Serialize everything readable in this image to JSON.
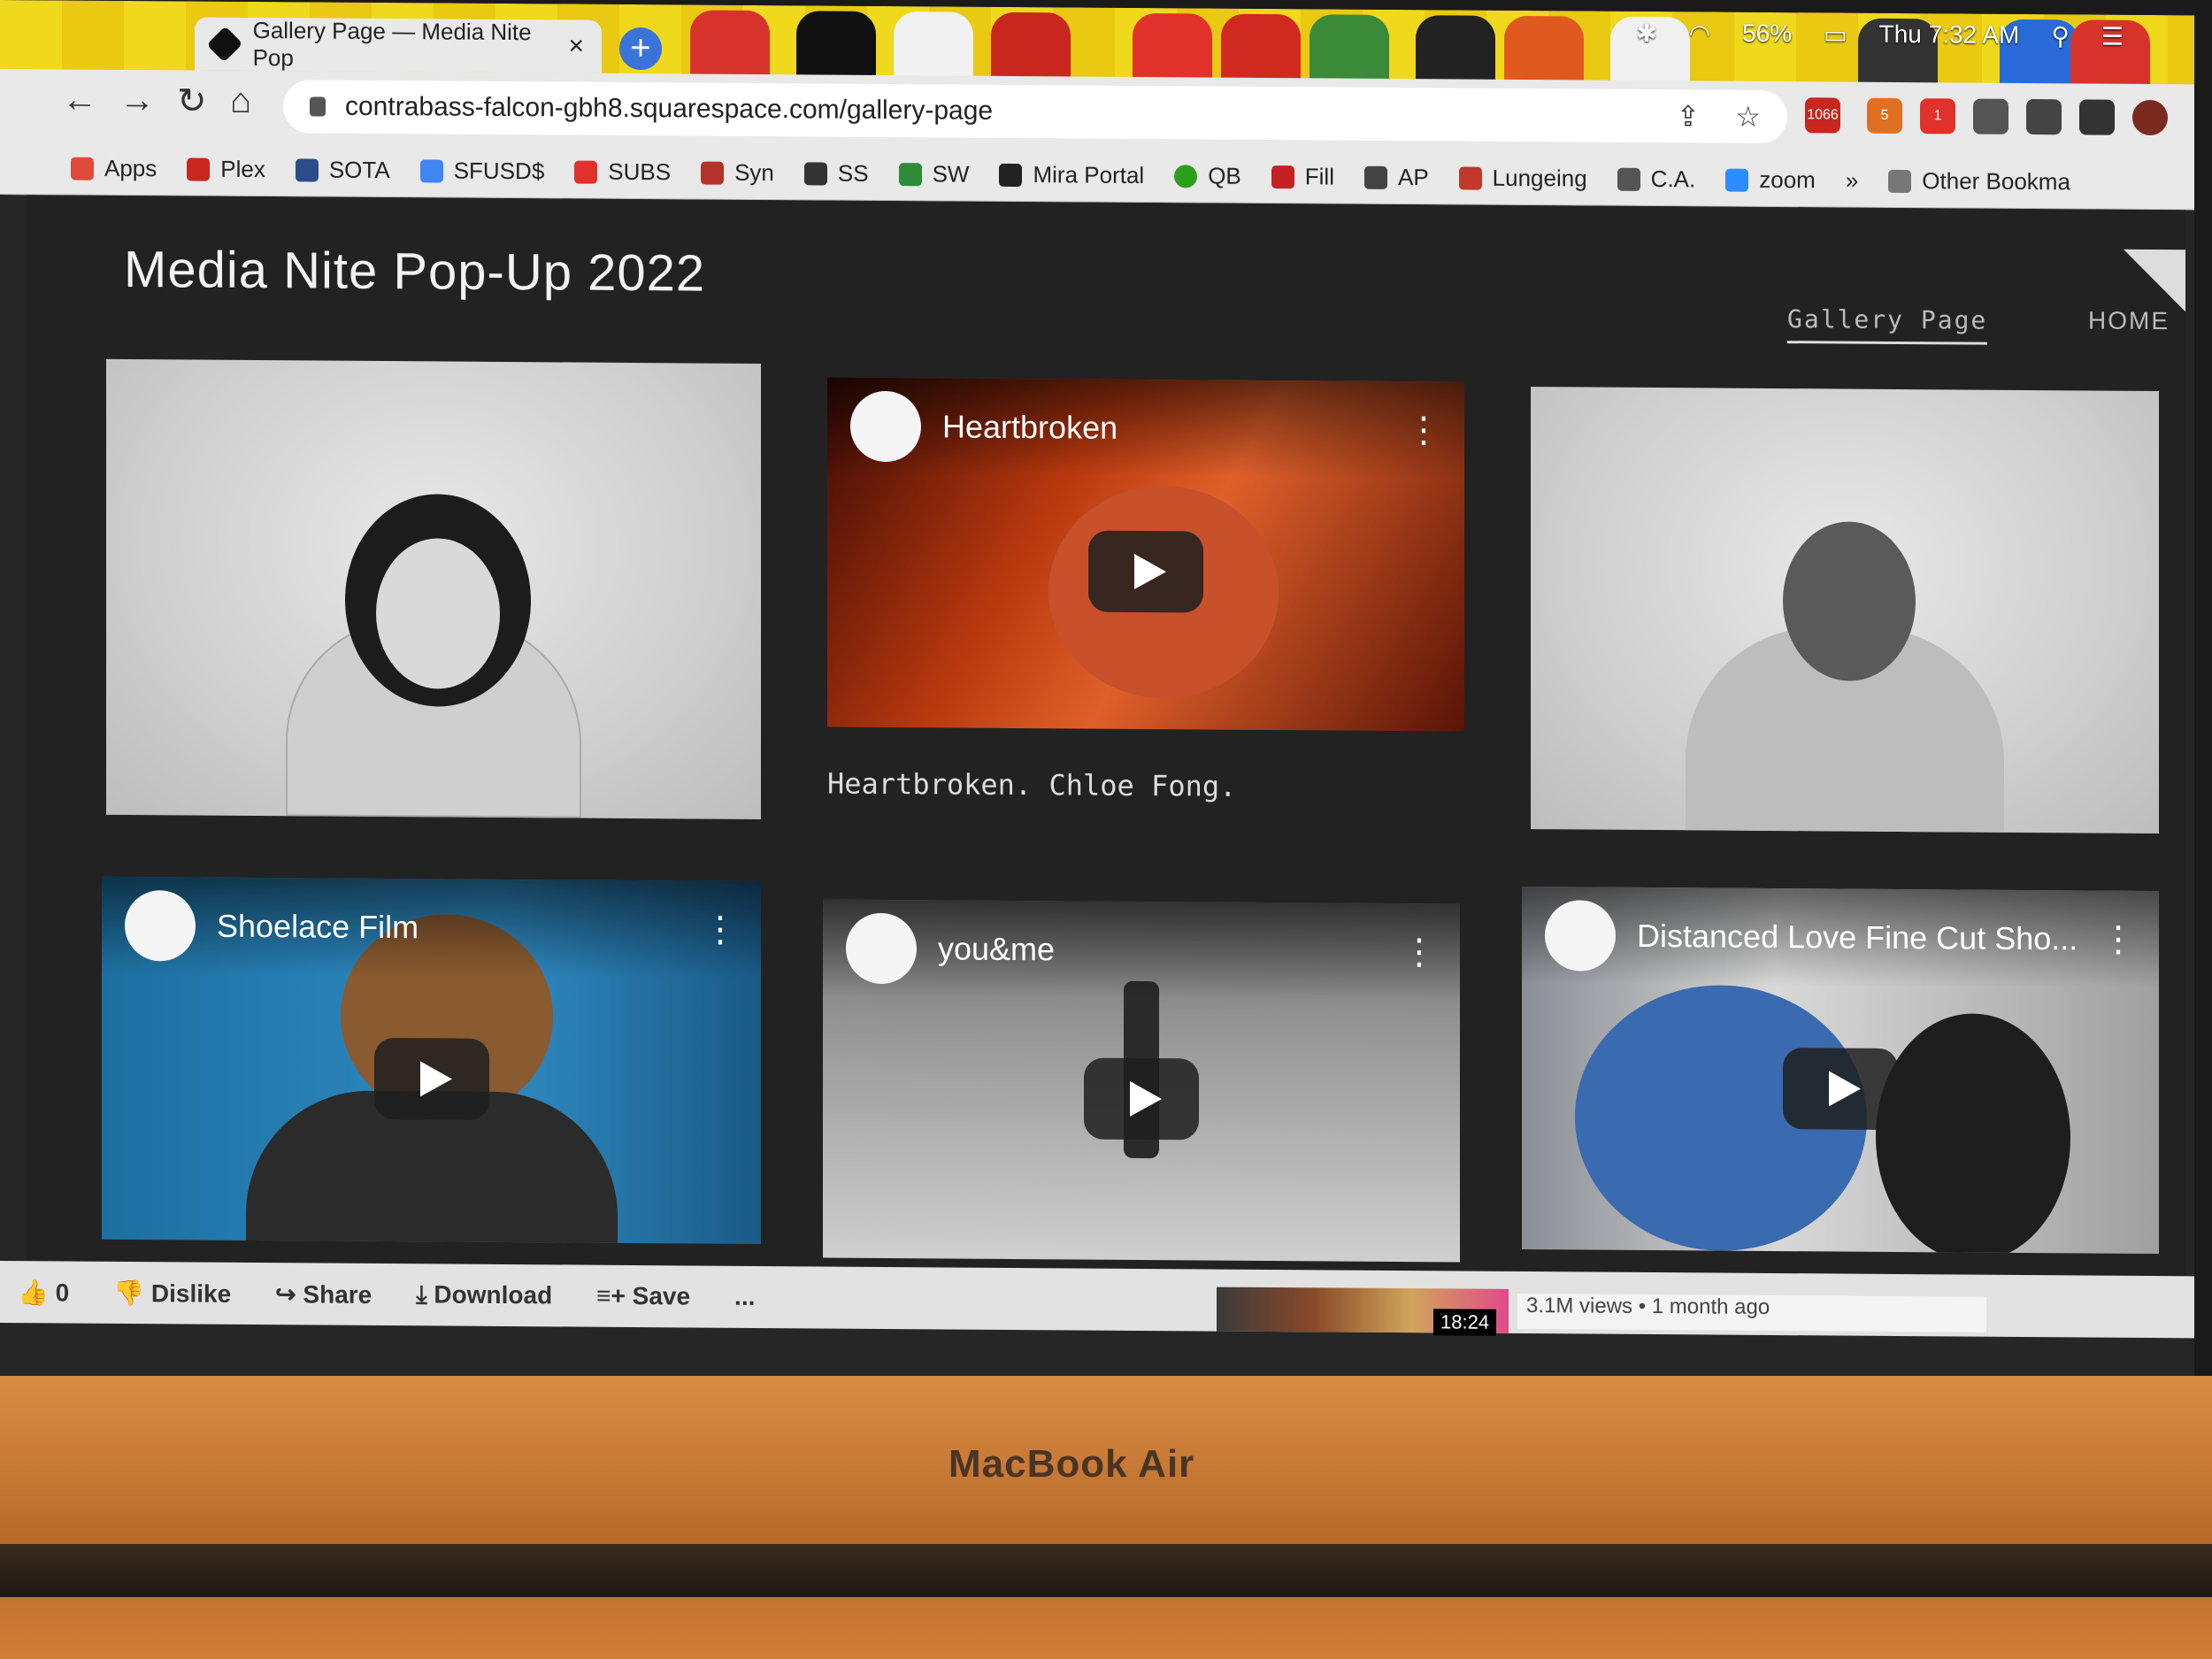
{
  "menubar": {
    "battery": "56%",
    "clock": "Thu 7:32 AM"
  },
  "browser": {
    "tab_title": "Gallery Page — Media Nite Pop",
    "tab_close": "×",
    "new_tab": "+",
    "url": "contrabass-falcon-gbh8.squarespace.com/gallery-page",
    "ext_badges": [
      "1066",
      "5",
      "1"
    ],
    "bookmarks": [
      {
        "label": "Apps",
        "color": "#e04a3a"
      },
      {
        "label": "Plex",
        "color": "#c8261e"
      },
      {
        "label": "SOTA",
        "color": "#2a4d8a"
      },
      {
        "label": "SFUSD$",
        "color": "#4285f4"
      },
      {
        "label": "SUBS",
        "color": "#e0312a"
      },
      {
        "label": "Syn",
        "color": "#b5322a"
      },
      {
        "label": "SS",
        "color": "#333333"
      },
      {
        "label": "SW",
        "color": "#2e8b3a"
      },
      {
        "label": "Mira Portal",
        "color": "#222222"
      },
      {
        "label": "QB",
        "color": "#2ca01c"
      },
      {
        "label": "Fill",
        "color": "#c62020"
      },
      {
        "label": "AP",
        "color": "#444444"
      },
      {
        "label": "Lungeing",
        "color": "#c0392b"
      },
      {
        "label": "C.A.",
        "color": "#555555"
      },
      {
        "label": "zoom",
        "color": "#2d8cff"
      }
    ],
    "more": "»",
    "other_bookmarks": "Other Bookma"
  },
  "site": {
    "title": "Media Nite Pop-Up 2022",
    "nav": [
      {
        "label": "Gallery Page"
      },
      {
        "label": "HOME"
      }
    ]
  },
  "videos": [
    {
      "title": "Heartbroken",
      "caption": "Heartbroken. Chloe Fong."
    },
    {
      "title": "Shoelace Film"
    },
    {
      "title": "you&me"
    },
    {
      "title": "Distanced Love Fine Cut Sho..."
    }
  ],
  "youtube_bar": {
    "likes": "0",
    "dislike": "Dislike",
    "share": "Share",
    "download": "Download",
    "save": "Save",
    "more": "...",
    "rec_duration": "18:24",
    "rec_meta": "3.1M views • 1 month ago"
  },
  "hardware": {
    "brand": "MacBook Air"
  }
}
